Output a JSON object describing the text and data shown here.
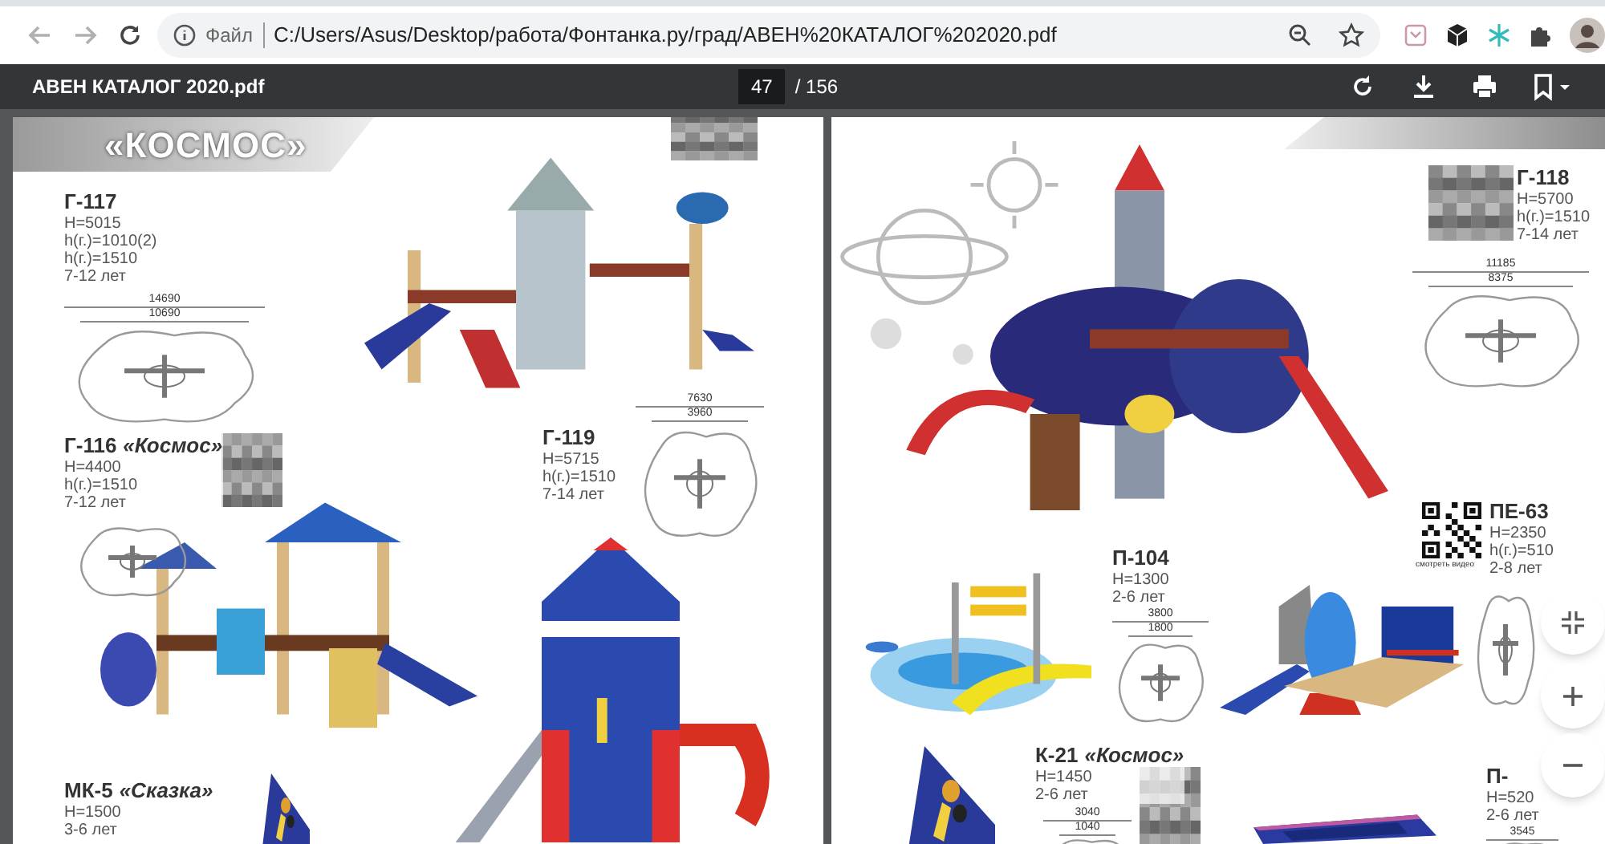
{
  "browser": {
    "scheme_label": "Файл",
    "url": "C:/Users/Asus/Desktop/работа/Фонтанка.ру/град/АВЕН%20КАТАЛОГ%202020.pdf"
  },
  "pdf_toolbar": {
    "title": "АВЕН КАТАЛОГ 2020.pdf",
    "page": "47",
    "page_count": "/ 156"
  },
  "pages": [
    {
      "banner": "«КОСМОС»",
      "products": [
        {
          "code": "Г-117",
          "specs": [
            "H=5015",
            "h(г.)=1010(2)",
            "h(г.)=1510",
            "7-12 лет"
          ],
          "dims": [
            "14690",
            "10690"
          ],
          "code_image": {
            "kind": "blurred"
          }
        },
        {
          "code": "Г-116",
          "name": "«Космос»",
          "specs": [
            "H=4400",
            "h(г.)=1510",
            "7-12 лет"
          ],
          "code_image": {
            "kind": "blurred"
          }
        },
        {
          "code": "Г-119",
          "specs": [
            "H=5715",
            "h(г.)=1510",
            "7-14 лет"
          ],
          "dims": [
            "7630",
            "3960"
          ]
        },
        {
          "code": "МК-5",
          "name": "«Сказка»",
          "specs": [
            "H=1500",
            "3-6 лет"
          ]
        }
      ]
    },
    {
      "products": [
        {
          "code": "Г-118",
          "specs": [
            "H=5700",
            "h(г.)=1510",
            "7-14 лет"
          ],
          "dims": [
            "11185",
            "8375"
          ],
          "code_image": {
            "kind": "blurred"
          }
        },
        {
          "code": "П-104",
          "specs": [
            "H=1300",
            "2-6 лет"
          ],
          "dims": [
            "3800",
            "1800"
          ]
        },
        {
          "code": "ПЕ-63",
          "specs": [
            "H=2350",
            "h(г.)=510",
            "2-8 лет"
          ],
          "code_image": {
            "kind": "qr",
            "caption": "смотреть видео"
          }
        },
        {
          "code": "К-21",
          "name": "«Космос»",
          "specs": [
            "H=1450",
            "2-6 лет"
          ],
          "dims": [
            "3040",
            "1040"
          ],
          "code_image": {
            "kind": "blurred"
          }
        },
        {
          "code": "П-",
          "specs": [
            "H=520",
            "2-6 лет"
          ],
          "dims": [
            "3545"
          ]
        }
      ]
    }
  ]
}
